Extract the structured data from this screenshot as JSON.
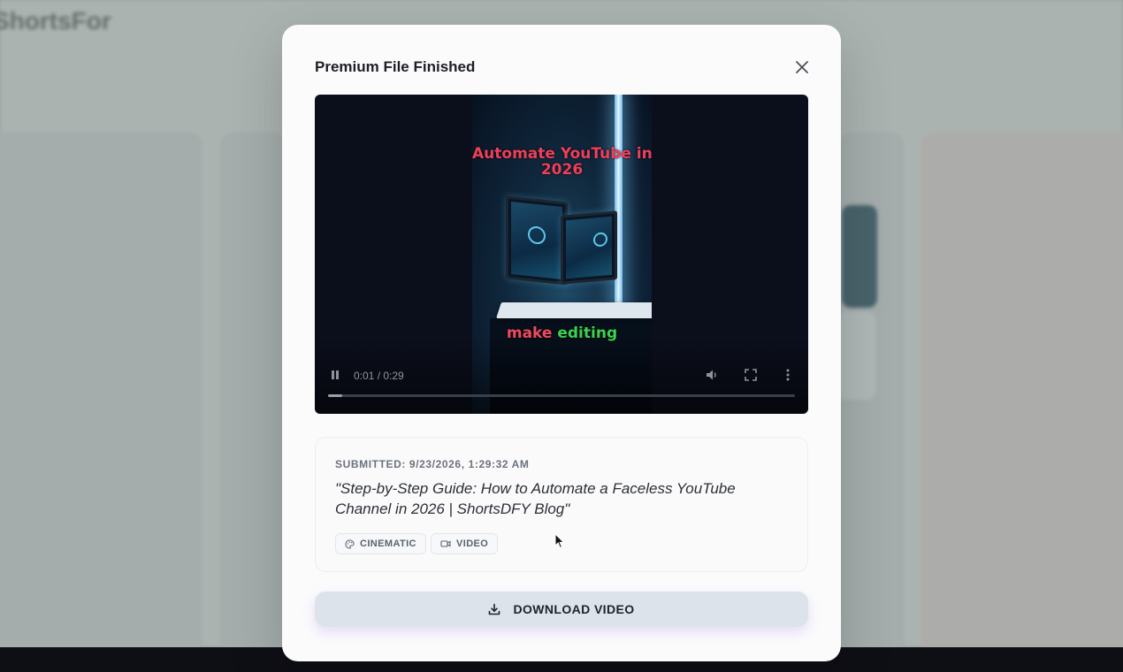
{
  "background": {
    "app_title": "ShortsFor",
    "columns": [
      "",
      "",
      "",
      ""
    ]
  },
  "modal": {
    "title": "Premium File Finished",
    "close_icon": "close-icon"
  },
  "video": {
    "overlay_top_text": "Automate YouTube in 2026",
    "overlay_top_line1": "Automate YouTube in",
    "overlay_top_line2": "2026",
    "caption_word1": "make",
    "caption_word2": "editing",
    "time": "0:01 / 0:29",
    "progress": 0.03,
    "icons": [
      "pause-icon",
      "volume-icon",
      "fullscreen-icon",
      "more-vertical-icon"
    ]
  },
  "submission": {
    "submitted_label": "SUBMITTED: 9/23/2026, 1:29:32 AM",
    "prompt": "\"Step-by-Step Guide: How to Automate a Faceless YouTube Channel in 2026 | ShortsDFY Blog\"",
    "tags": [
      {
        "label": "CINEMATIC",
        "icon": "palette-icon"
      },
      {
        "label": "VIDEO",
        "icon": "video-camera-icon"
      }
    ]
  },
  "actions": {
    "download_label": "DOWNLOAD VIDEO",
    "download_icon": "download-icon"
  },
  "colors": {
    "caption_red": "#ef4a5e",
    "caption_green": "#3ed14f",
    "overlay_title_red": "#ee3f5b"
  }
}
